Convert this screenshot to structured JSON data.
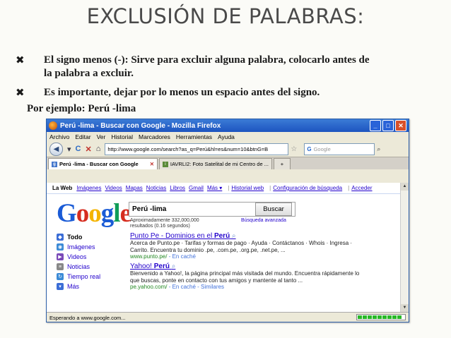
{
  "slide": {
    "title": "EXCLUSIÓN DE PALABRAS:",
    "bullets": [
      {
        "mark": "✖",
        "line1": "El signo menos (-): Sirve  para excluir alguna palabra, colocarlo antes de",
        "line2": "la palabra a excluir."
      },
      {
        "mark": "✖",
        "line1": "Es importante, dejar por lo menos un espacio antes del signo."
      }
    ],
    "example": "Por ejemplo: Perú -lima"
  },
  "browser": {
    "window_title": "Perú -lima - Buscar con Google - Mozilla Firefox",
    "win_buttons": {
      "min": "_",
      "max": "□",
      "close": "✕"
    },
    "menu": [
      "Archivo",
      "Editar",
      "Ver",
      "Historial",
      "Marcadores",
      "Herramientas",
      "Ayuda"
    ],
    "nav": {
      "back": "◀",
      "dropdown": "▾",
      "reload": "C",
      "stop": "✕",
      "home": "⌂"
    },
    "url": "http://www.google.com/search?as_q=Perú&hl=es&num=10&btnG=B",
    "search_engine": "G",
    "search_placeholder": "Google",
    "tabs": [
      {
        "label": "Perú -lima - Buscar con Google",
        "active": true
      },
      {
        "label": "IAVRLI2: Foto Satelital de mi Centro de ...",
        "active": false
      }
    ],
    "new_tab": "+",
    "progress_fraction": 0.9,
    "status_text": "Esperando a www.google.com..."
  },
  "google": {
    "gbar": {
      "current": "La Web",
      "links": [
        "Imágenes",
        "Videos",
        "Mapas",
        "Noticias",
        "Libros",
        "Gmail"
      ],
      "more": "Más ▾",
      "right_links": [
        "Historial web",
        "Configuración de búsqueda",
        "Acceder"
      ]
    },
    "logo_letters": [
      {
        "ch": "G",
        "color": "#1a5bd6"
      },
      {
        "ch": "o",
        "color": "#d62d20"
      },
      {
        "ch": "o",
        "color": "#f4b400"
      },
      {
        "ch": "g",
        "color": "#1a5bd6"
      },
      {
        "ch": "l",
        "color": "#109d58"
      },
      {
        "ch": "e",
        "color": "#d62d20"
      }
    ],
    "query": "Perú -lima",
    "search_button": "Buscar",
    "stats_line1": "Aproximadamente 332,000,000",
    "stats_line2": "resultados (0.16 segundos)",
    "advanced": "Búsqueda avanzada",
    "sidebar": [
      {
        "label": "Todo",
        "icon_color": "#3b6dd6",
        "current": true
      },
      {
        "label": "Imágenes",
        "icon_color": "#3b8ad6"
      },
      {
        "label": "Videos",
        "icon_color": "#7a4ab8"
      },
      {
        "label": "Noticias",
        "icon_color": "#888888"
      },
      {
        "label": "Tiempo real",
        "icon_color": "#3b8ad6"
      },
      {
        "label": "Más",
        "icon_color": "#3b6dd6"
      }
    ],
    "results": [
      {
        "title_pre": "Punto Pe - Dominios en el ",
        "title_bold": "Perú",
        "snippet1": "Acerca de Punto.pe · Tarifas y formas de pago · Ayuda · Contáctanos · Whois · Ingresa ·",
        "snippet2": "Carrito. Encuentra tu dominio .pe, .com.pe, .org.pe, .net.pe, ...",
        "url": "www.punto.pe/",
        "cache": " - En caché"
      },
      {
        "title_pre": "Yahoo! ",
        "title_bold": "Perú",
        "snippet1": "Bienvenido a Yahoo!, la página principal más visitada del mundo. Encuentra rápidamente lo",
        "snippet2": "que buscas, ponte en contacto con tus amigos y mantente al tanto ...",
        "url": "pe.yahoo.com/",
        "cache": " - En caché - Similares"
      }
    ]
  }
}
